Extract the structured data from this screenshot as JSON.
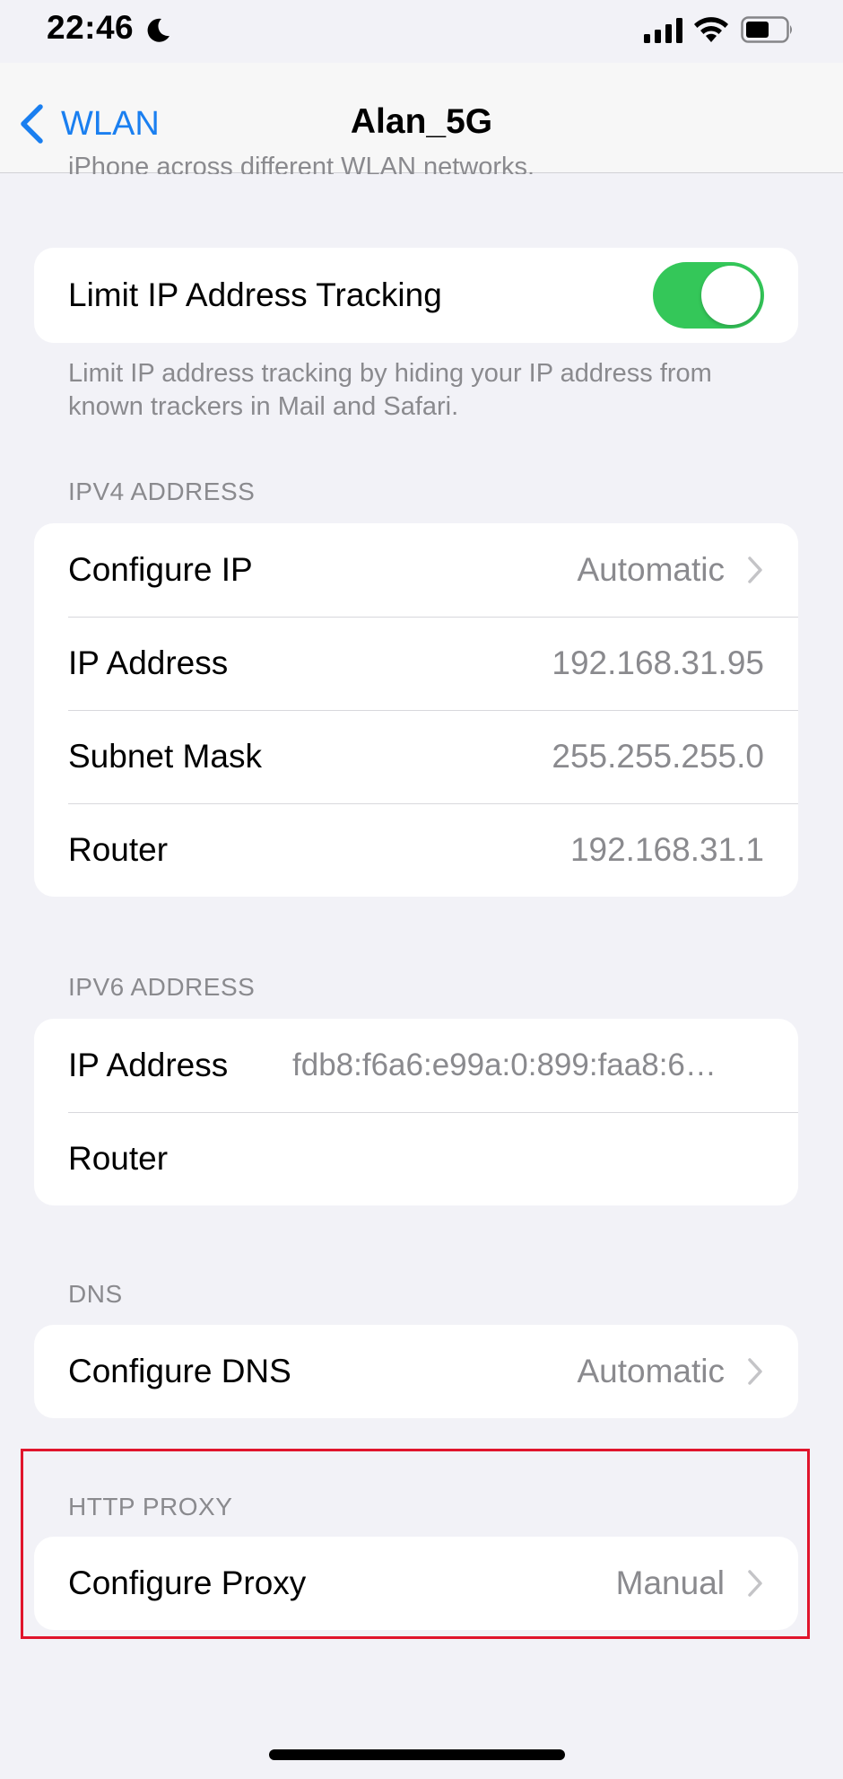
{
  "status_bar": {
    "time": "22:46"
  },
  "nav": {
    "back_label": "WLAN",
    "title": "Alan_5G"
  },
  "partial_footnote": "iPhone across different WLAN networks.",
  "limit_ip": {
    "label": "Limit IP Address Tracking",
    "enabled": true,
    "footnote": "Limit IP address tracking by hiding your IP address from known trackers in Mail and Safari."
  },
  "ipv4": {
    "header": "IPV4 ADDRESS",
    "configure_ip": {
      "label": "Configure IP",
      "value": "Automatic"
    },
    "ip_address": {
      "label": "IP Address",
      "value": "192.168.31.95"
    },
    "subnet_mask": {
      "label": "Subnet Mask",
      "value": "255.255.255.0"
    },
    "router": {
      "label": "Router",
      "value": "192.168.31.1"
    }
  },
  "ipv6": {
    "header": "IPV6 ADDRESS",
    "ip_address": {
      "label": "IP Address",
      "value": "fdb8:f6a6:e99a:0:899:faa8:6…"
    },
    "router": {
      "label": "Router",
      "value": ""
    }
  },
  "dns": {
    "header": "DNS",
    "configure_dns": {
      "label": "Configure DNS",
      "value": "Automatic"
    }
  },
  "http_proxy": {
    "header": "HTTP PROXY",
    "configure_proxy": {
      "label": "Configure Proxy",
      "value": "Manual"
    }
  },
  "colors": {
    "accent": "#0a84ff",
    "toggle_on": "#34c759",
    "highlight": "#e0152c"
  }
}
